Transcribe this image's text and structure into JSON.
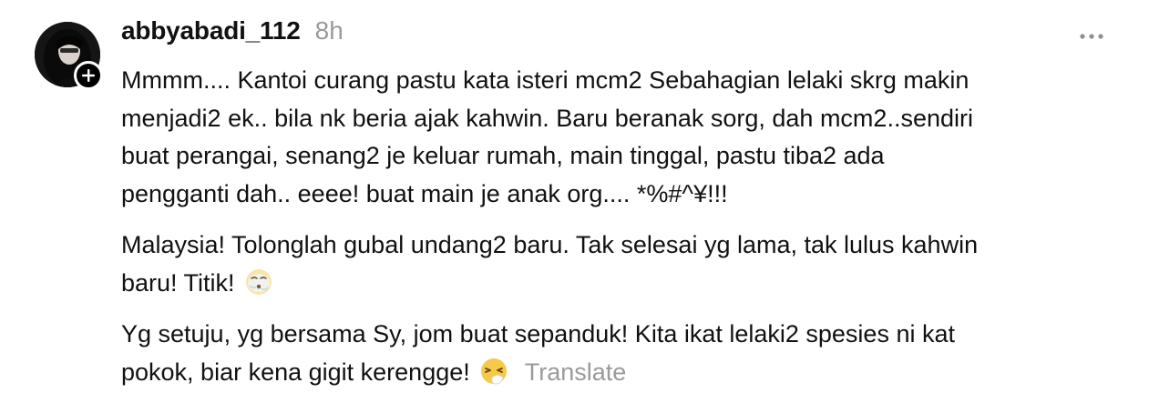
{
  "post": {
    "username": "abbyabadi_112",
    "timestamp": "8h",
    "paragraphs": [
      {
        "lines": [
          "Mmmm.... Kantoi curang pastu kata isteri mcm2 Sebahagian lelaki skrg makin",
          "menjadi2 ek.. bila nk beria ajak kahwin. Baru beranak sorg, dah mcm2..sendiri",
          "buat perangai, senang2 je keluar rumah, main tinggal, pastu tiba2 ada",
          "pengganti dah.. eeee! buat main je anak org.... *%#^¥!!!"
        ]
      },
      {
        "lines": [
          "Malaysia! Tolonglah gubal undang2 baru. Tak selesai yg lama, tak lulus kahwin",
          "baru! Titik!"
        ],
        "emoji": "face-exhaling-emoji"
      },
      {
        "lines": [
          "Yg setuju, yg bersama Sy, jom buat sepanduk! Kita ikat lelaki2 spesies ni kat",
          "pokok, biar kena gigit kerengge!"
        ],
        "emoji": "sneezing-face-emoji"
      }
    ],
    "translate_label": "Translate"
  },
  "icons": {
    "follow": "plus-icon",
    "more": "more-horizontal-icon"
  },
  "colors": {
    "text": "#111111",
    "muted": "#9a9a9a",
    "badge": "#000000",
    "background": "#ffffff"
  }
}
